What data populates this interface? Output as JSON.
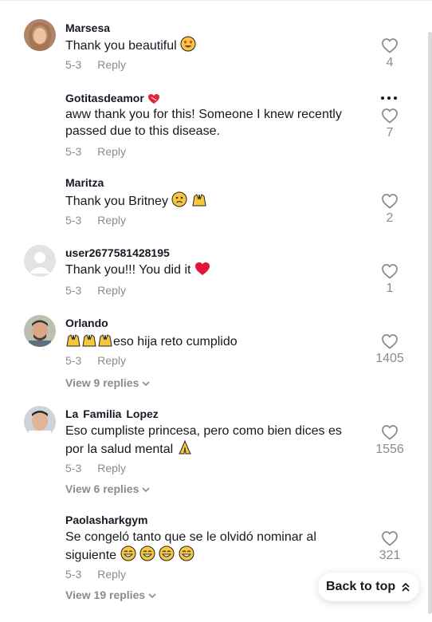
{
  "comments": [
    {
      "username": "Marsesa",
      "text": "Thank you beautiful",
      "date": "5-3",
      "reply_label": "Reply",
      "likes": "4"
    },
    {
      "username": "Gotitasdeamor",
      "text": "aww thank you for this! Someone I knew recently passed due to this disease.",
      "date": "5-3",
      "reply_label": "Reply",
      "likes": "7"
    },
    {
      "username": "Maritza",
      "text": "Thank you Britney",
      "date": "5-3",
      "reply_label": "Reply",
      "likes": "2"
    },
    {
      "username": "user2677581428195",
      "text": "Thank you!!! You did it",
      "date": "5-3",
      "reply_label": "Reply",
      "likes": "1"
    },
    {
      "username": "Orlando",
      "text": "eso hija reto cumplido",
      "date": "5-3",
      "reply_label": "Reply",
      "likes": "1405",
      "view_replies": "View 9 replies"
    },
    {
      "username": "La  Familia  Lopez",
      "text": "Eso cumpliste princesa, pero como bien dices es por la salud mental",
      "date": "5-3",
      "reply_label": "Reply",
      "likes": "1556",
      "view_replies": "View 6 replies"
    },
    {
      "username": "Paolasharkgym",
      "text": "Se congeló tanto que se le olvidó nominar al siguiente",
      "date": "5-3",
      "reply_label": "Reply",
      "likes": "321",
      "view_replies": "View 19 replies"
    }
  ],
  "back_to_top": "Back to top",
  "colors": {
    "text": "#161823",
    "muted": "#8a8b91",
    "heart": "#8a8b91"
  },
  "icons": [
    "heart-icon",
    "more-icon",
    "chevron-down-icon",
    "arrow-up-icon"
  ]
}
